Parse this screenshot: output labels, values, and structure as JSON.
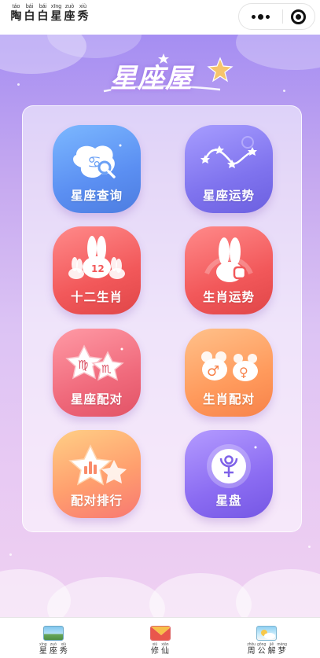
{
  "header": {
    "title_chars": [
      {
        "py": "táo",
        "hz": "陶"
      },
      {
        "py": "bái",
        "hz": "白"
      },
      {
        "py": "bái",
        "hz": "白"
      },
      {
        "py": "xīng",
        "hz": "星"
      },
      {
        "py": "zuò",
        "hz": "座"
      },
      {
        "py": "xiù",
        "hz": "秀"
      }
    ]
  },
  "capsule": {
    "more_icon": "more-dots-icon",
    "close_icon": "target-close-icon"
  },
  "logo": {
    "text": "星座屋"
  },
  "tiles": [
    {
      "label": "星座查询",
      "icon": "cancer-search-icon",
      "color": "#5b8ff2"
    },
    {
      "label": "星座运势",
      "icon": "constellation-chart-icon",
      "color": "#7f73ee"
    },
    {
      "label": "十二生肖",
      "icon": "rabbit-12-icon",
      "color": "#f2585a"
    },
    {
      "label": "生肖运势",
      "icon": "rabbit-fortune-icon",
      "color": "#f2585a"
    },
    {
      "label": "星座配对",
      "icon": "virgo-scorpio-stars-icon",
      "color": "#f06a7c"
    },
    {
      "label": "生肖配对",
      "icon": "male-female-icon",
      "color": "#ff9a5c"
    },
    {
      "label": "配对排行",
      "icon": "ranking-star-icon",
      "color": "#ff9f6e"
    },
    {
      "label": "星盘",
      "icon": "pluto-symbol-icon",
      "color": "#8b6cf2"
    }
  ],
  "bottom_nav": [
    {
      "icon": "landscape-picture-icon",
      "chars": [
        {
          "py": "xīng",
          "hz": "星"
        },
        {
          "py": "zuò",
          "hz": "座"
        },
        {
          "py": "xiù",
          "hz": "秀"
        }
      ]
    },
    {
      "icon": "mail-envelope-icon",
      "chars": [
        {
          "py": "xiū",
          "hz": "修"
        },
        {
          "py": "xiān",
          "hz": "仙"
        }
      ]
    },
    {
      "icon": "weather-picture-icon",
      "chars": [
        {
          "py": "zhōu",
          "hz": "周"
        },
        {
          "py": "gōng",
          "hz": "公"
        },
        {
          "py": "jiě",
          "hz": "解"
        },
        {
          "py": "mèng",
          "hz": "梦"
        }
      ]
    }
  ]
}
